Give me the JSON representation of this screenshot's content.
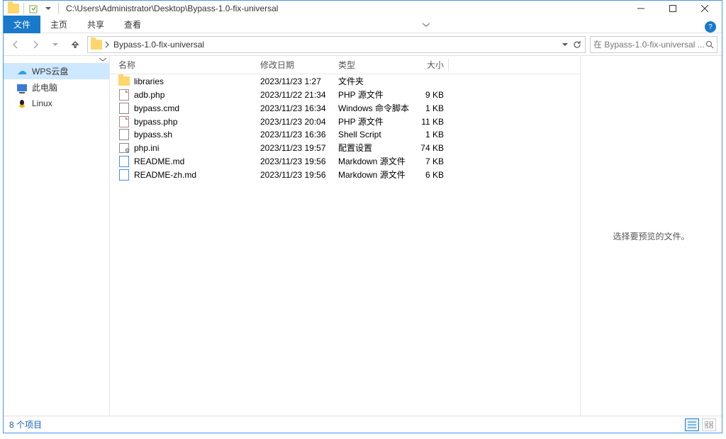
{
  "title_path": "C:\\Users\\Administrator\\Desktop\\Bypass-1.0-fix-universal",
  "ribbon": {
    "file": "文件",
    "home": "主页",
    "share": "共享",
    "view": "查看"
  },
  "breadcrumb": {
    "part1": "Bypass-1.0-fix-universal"
  },
  "search": {
    "placeholder": "在 Bypass-1.0-fix-universal ..."
  },
  "navpane": {
    "wps": "WPS云盘",
    "thispc": "此电脑",
    "linux": "Linux"
  },
  "columns": {
    "name": "名称",
    "date": "修改日期",
    "type": "类型",
    "size": "大小"
  },
  "files": [
    {
      "icon": "folder",
      "name": "libraries",
      "date": "2023/11/23 1:27",
      "type": "文件夹",
      "size": ""
    },
    {
      "icon": "php",
      "name": "adb.php",
      "date": "2023/11/22 21:34",
      "type": "PHP 源文件",
      "size": "9 KB"
    },
    {
      "icon": "cmd",
      "name": "bypass.cmd",
      "date": "2023/11/23 16:34",
      "type": "Windows 命令脚本",
      "size": "1 KB"
    },
    {
      "icon": "php",
      "name": "bypass.php",
      "date": "2023/11/23 20:04",
      "type": "PHP 源文件",
      "size": "11 KB"
    },
    {
      "icon": "sh",
      "name": "bypass.sh",
      "date": "2023/11/23 16:36",
      "type": "Shell Script",
      "size": "1 KB"
    },
    {
      "icon": "ini",
      "name": "php.ini",
      "date": "2023/11/23 19:57",
      "type": "配置设置",
      "size": "74 KB"
    },
    {
      "icon": "md",
      "name": "README.md",
      "date": "2023/11/23 19:56",
      "type": "Markdown 源文件",
      "size": "7 KB"
    },
    {
      "icon": "md",
      "name": "README-zh.md",
      "date": "2023/11/23 19:56",
      "type": "Markdown 源文件",
      "size": "6 KB"
    }
  ],
  "preview_hint": "选择要预览的文件。",
  "statusbar": {
    "count": "8 个项目"
  }
}
